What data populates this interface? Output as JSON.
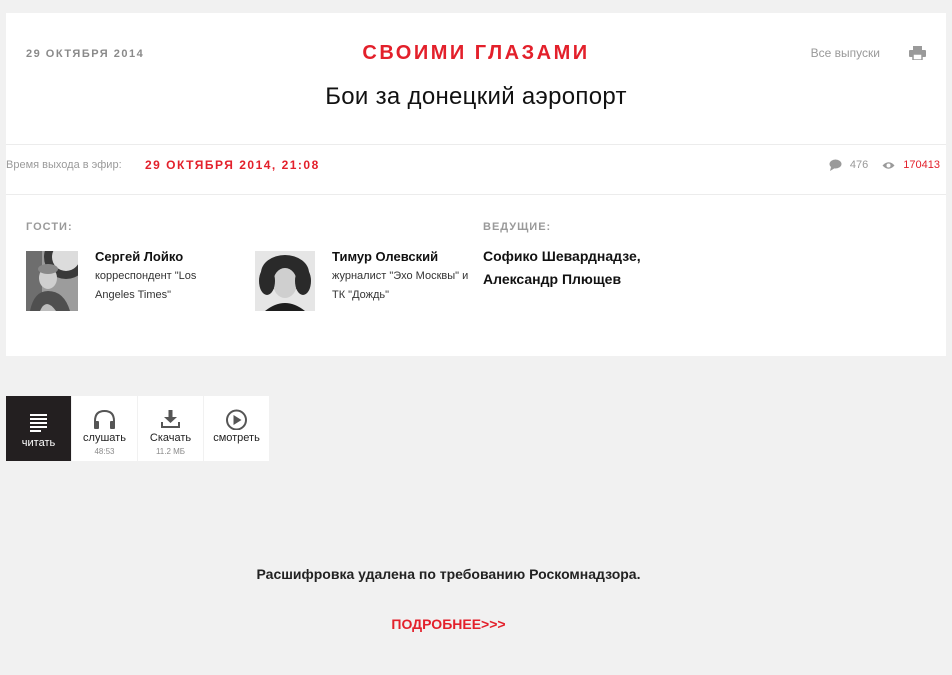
{
  "header": {
    "top_date": "29 ОКТЯБРЯ 2014",
    "program_title": "СВОИМИ ГЛАЗАМИ",
    "all_issues_label": "Все выпуски",
    "episode_title": "Бои за донецкий аэропорт"
  },
  "air": {
    "label": "Время выхода в эфир:",
    "datetime": "29 ОКТЯБРЯ 2014, 21:08",
    "comments_count": "476",
    "views_count": "170413"
  },
  "guests": {
    "label": "ГОСТИ:",
    "items": [
      {
        "name": "Сергей Лойко",
        "role": "корреспондент \"Los Angeles Times\""
      },
      {
        "name": "Тимур Олевский",
        "role": "журналист \"Эхо Москвы\" и ТК \"Дождь\""
      }
    ]
  },
  "hosts": {
    "label": "ВЕДУЩИЕ:",
    "names": "Софико Шеварднадзе, Александр Плющев"
  },
  "media_tabs": [
    {
      "label": "читать",
      "icon": "text-lines-icon",
      "active": true
    },
    {
      "label": "слушать",
      "sub": "48:53",
      "icon": "headphones-icon"
    },
    {
      "label": "Скачать",
      "sub": "11.2 МБ",
      "icon": "download-icon"
    },
    {
      "label": "смотреть",
      "icon": "play-circle-icon"
    }
  ],
  "notice": {
    "text": "Расшифровка удалена по требованию Роскомнадзора.",
    "link": "ПОДРОБНЕЕ>>>"
  },
  "colors": {
    "accent": "#e3202b",
    "background": "#f1f1f1",
    "active_tab": "#231f20"
  }
}
